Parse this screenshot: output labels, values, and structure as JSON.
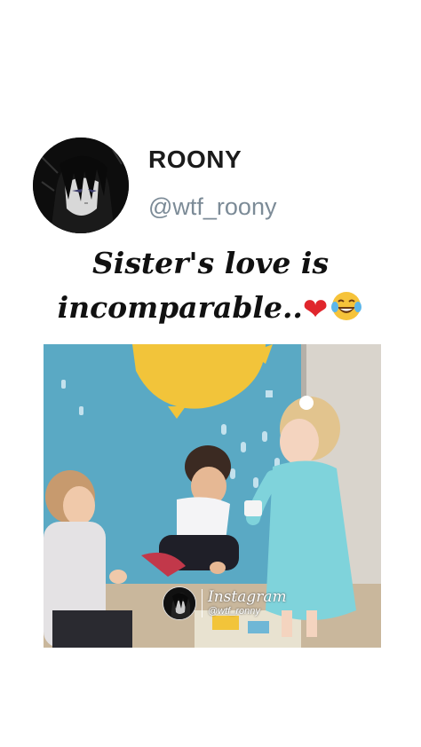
{
  "post": {
    "display_name": "ROONY",
    "handle": "@wtf_roony",
    "caption_line1": "Sister's love is",
    "caption_line2": "incomparable..",
    "caption_emojis": [
      "red-heart",
      "tears-of-joy-face"
    ]
  },
  "video": {
    "watermark": {
      "brand": "Instagram",
      "handle": "@wtf_ronny"
    }
  },
  "colors": {
    "background": "#ffffff",
    "name": "#1b1b1b",
    "handle": "#7c8b97",
    "heart": "#e0262c",
    "video_wall": "#58a6c2"
  }
}
